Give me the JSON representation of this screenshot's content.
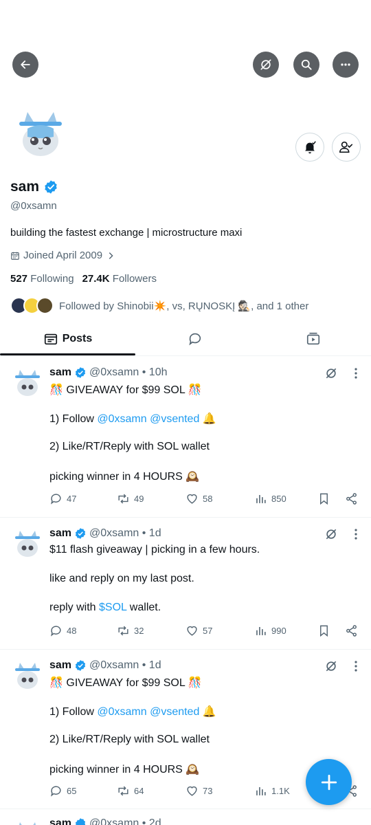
{
  "profile": {
    "name": "sam",
    "handle": "@0xsamn",
    "bio": "building the fastest exchange | microstructure maxi",
    "joined": "Joined April 2009",
    "following_count": "527",
    "following_label": "Following",
    "followers_count": "27.4K",
    "followers_label": "Followers",
    "followed_by": "Followed by Shinobii✴️, vs, RŲNOSKĮ 🕵🏻, and 1 other"
  },
  "tabs": [
    {
      "label": "Posts",
      "icon": "posts-icon",
      "active": true
    },
    {
      "label": "",
      "icon": "replies-icon",
      "active": false
    },
    {
      "label": "",
      "icon": "media-icon",
      "active": false
    }
  ],
  "posts": [
    {
      "name": "sam",
      "meta": "@0xsamn • 10h",
      "line1": "🎊 GIVEAWAY for $99 SOL 🎊",
      "line2_pre": "1) Follow ",
      "line2_link": "@0xsamn @vsented",
      "line2_post": " 🔔",
      "line3": "2) Like/RT/Reply with SOL wallet",
      "line4": "picking winner in 4 HOURS 🕰️",
      "replies": "47",
      "reposts": "49",
      "likes": "58",
      "views": "850"
    },
    {
      "name": "sam",
      "meta": "@0xsamn • 1d",
      "line1": "$11 flash giveaway | picking in a few hours.",
      "line2": "like and reply on my last post.",
      "line3_pre": "reply with ",
      "line3_link": "$SOL",
      "line3_post": " wallet.",
      "replies": "48",
      "reposts": "32",
      "likes": "57",
      "views": "990"
    },
    {
      "name": "sam",
      "meta": "@0xsamn • 1d",
      "line1": "🎊 GIVEAWAY for $99 SOL 🎊",
      "line2_pre": "1) Follow ",
      "line2_link": "@0xsamn @vsented",
      "line2_post": " 🔔",
      "line3": "2) Like/RT/Reply with SOL wallet",
      "line4": "picking winner in 4 HOURS 🕰️",
      "replies": "65",
      "reposts": "64",
      "likes": "73",
      "views": "1.1K"
    },
    {
      "name": "sam",
      "meta": "@0xsamn • 2d"
    }
  ],
  "colors": {
    "accent": "#1d9bf0",
    "text": "#0f1419",
    "muted": "#536471",
    "border": "#eff3f4"
  }
}
